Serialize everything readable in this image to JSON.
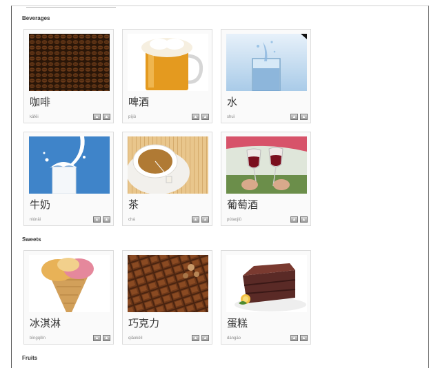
{
  "sections": [
    {
      "title": "Beverages"
    },
    {
      "title": "Sweets"
    },
    {
      "title": "Fruits"
    }
  ],
  "cards": [
    {
      "word": "咖啡",
      "pinyin": "kāfēi",
      "image": "coffee-beans-image"
    },
    {
      "word": "啤酒",
      "pinyin": "píjiǔ",
      "image": "beer-mug-image"
    },
    {
      "word": "水",
      "pinyin": "shuǐ",
      "image": "water-glass-image"
    },
    {
      "word": "牛奶",
      "pinyin": "niúnǎi",
      "image": "milk-glass-image"
    },
    {
      "word": "茶",
      "pinyin": "chá",
      "image": "tea-cup-image"
    },
    {
      "word": "葡萄酒",
      "pinyin": "pútaojiǔ",
      "image": "wine-glasses-image"
    },
    {
      "word": "冰淇淋",
      "pinyin": "bīngqílín",
      "image": "ice-cream-image"
    },
    {
      "word": "巧克力",
      "pinyin": "qiǎokèlì",
      "image": "chocolate-image"
    },
    {
      "word": "蛋糕",
      "pinyin": "dàngāo",
      "image": "cake-image"
    }
  ],
  "icons": {
    "audio": "speaker-icon",
    "record": "record-icon"
  },
  "colors": {
    "card_border": "#dcdcdc",
    "button": "#9a9a9a"
  }
}
